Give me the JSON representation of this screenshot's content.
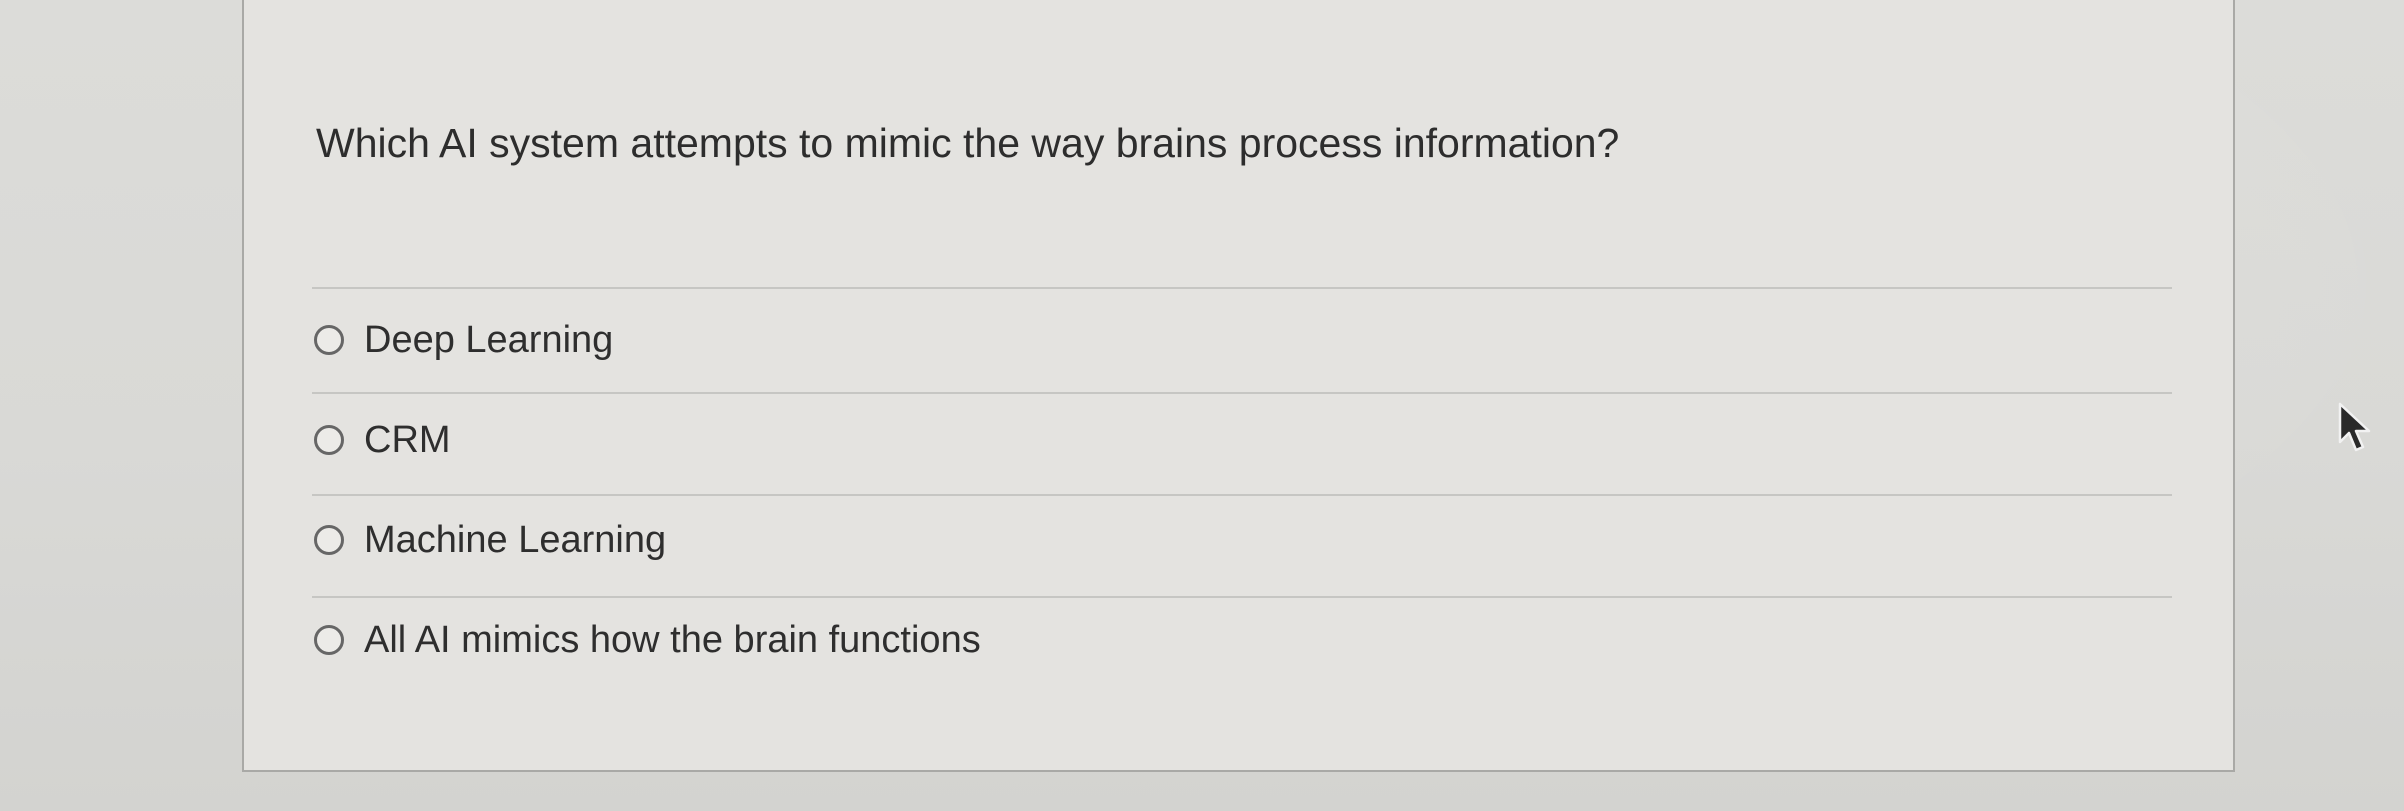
{
  "question": {
    "text": "Which AI system attempts to mimic the way brains process information?"
  },
  "options": [
    {
      "label": "Deep Learning",
      "selected": false
    },
    {
      "label": "CRM",
      "selected": false
    },
    {
      "label": "Machine Learning",
      "selected": false
    },
    {
      "label": "All AI mimics how the brain functions",
      "selected": false
    }
  ],
  "icons": {
    "radio": "radio-button-icon",
    "cursor": "mouse-pointer-icon"
  },
  "colors": {
    "background": "#dadad7",
    "card": "#e4e3e0",
    "text": "#2d2d2d"
  }
}
